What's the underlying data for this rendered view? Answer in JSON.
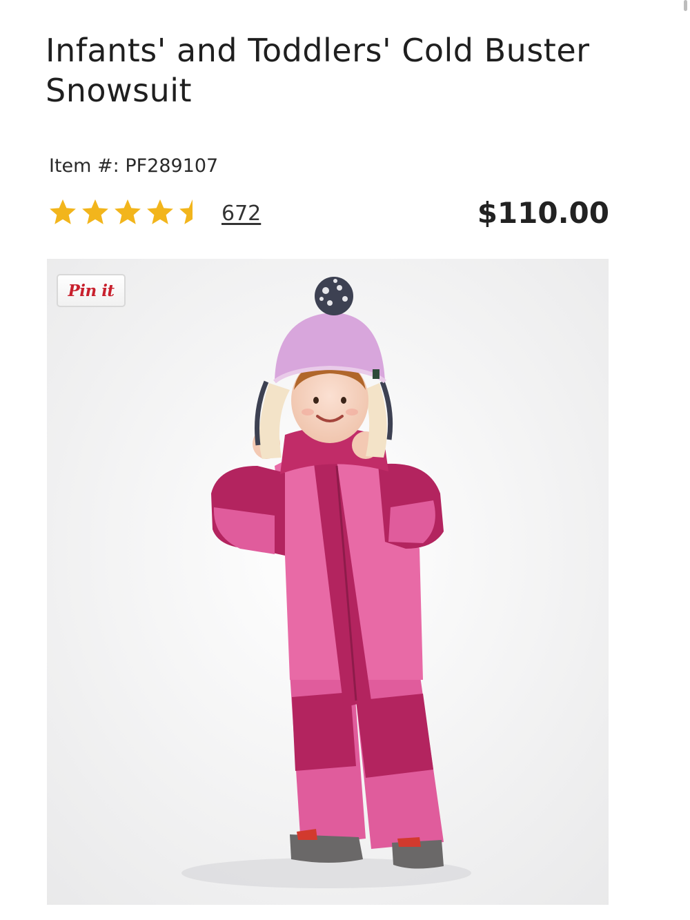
{
  "product": {
    "title": "Infants' and Toddlers' Cold Buster Snowsuit",
    "item_number": "Item #: PF289107",
    "rating": 4.5,
    "rating_max": 5,
    "review_count": "672",
    "price": "$110.00"
  },
  "image": {
    "pin_label": "Pin it",
    "subject": "toddler in pink snowsuit and lavender pom-pom hat"
  },
  "colors": {
    "star_gold": "#f2b51c",
    "pin_red": "#c8202d",
    "snowsuit_pink": "#e05c9c",
    "snowsuit_berry": "#b3245f",
    "hat_lavender": "#d8a6dc"
  },
  "icons": {
    "star": "star-icon",
    "half_star": "star-half-icon",
    "scroll": "scrollbar-thumb"
  }
}
